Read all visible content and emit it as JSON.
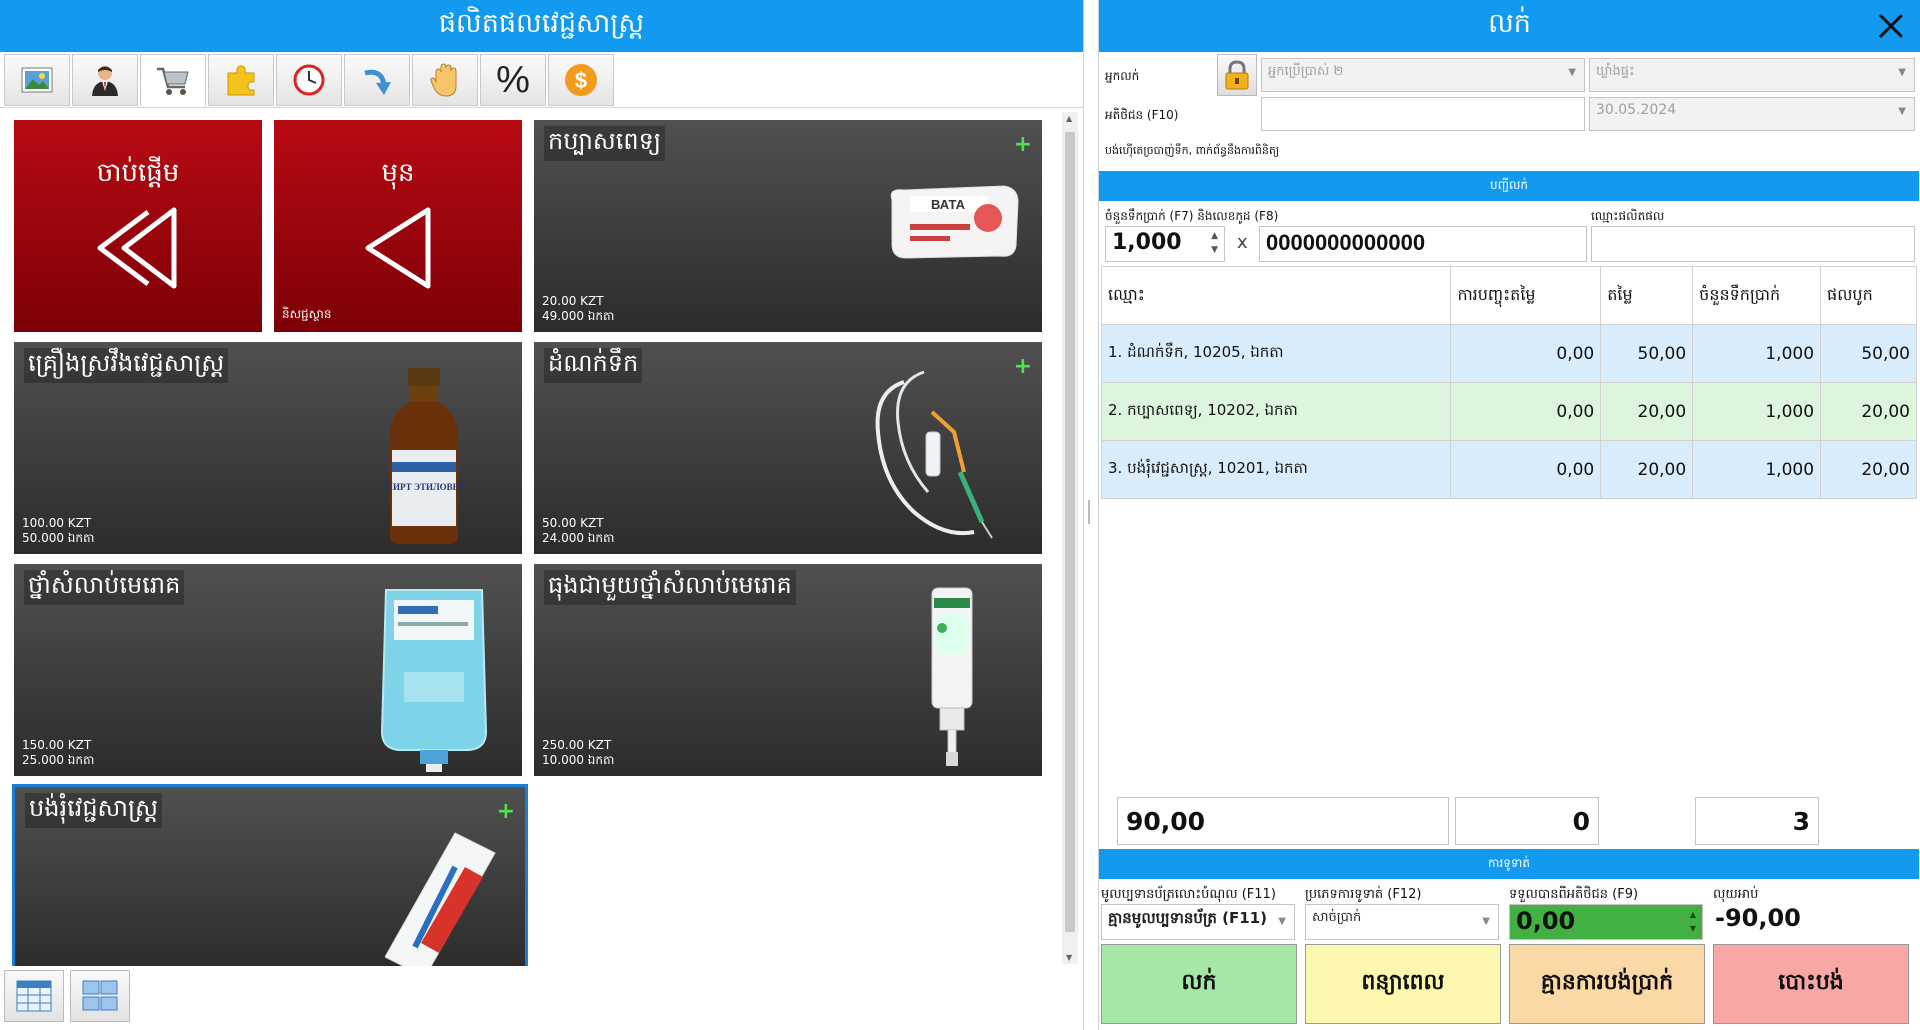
{
  "left": {
    "title": "ផលិតផលវេជ្ជសាស្ត្រ",
    "toolbar": [
      {
        "icon": "image-icon",
        "glyph": "🖼"
      },
      {
        "icon": "user-icon",
        "glyph": "👤"
      },
      {
        "icon": "cart-icon",
        "glyph": "🛒"
      },
      {
        "icon": "puzzle-icon",
        "glyph": "🧩"
      },
      {
        "icon": "clock-icon",
        "glyph": "🕓"
      },
      {
        "icon": "redo-arrow-icon",
        "glyph": "↷"
      },
      {
        "icon": "hand-icon",
        "glyph": "✋"
      },
      {
        "icon": "percent-icon",
        "glyph": "%"
      },
      {
        "icon": "dollar-coin-icon",
        "glyph": "$"
      }
    ],
    "tiles": {
      "start": {
        "label": "ចាប់ផ្តើម"
      },
      "prev": {
        "label": "មុន",
        "sub": "និសជ្ជស្ថាន"
      },
      "cotton": {
        "name": "កប្បាសពេទ្យ",
        "price": "20.00 KZT",
        "stock": "49.000 ឯកតា",
        "pkg_text": "ВАТА"
      },
      "alcohol": {
        "name": "គ្រឿងស្រវឹងវេជ្ជសាស្ត្រ",
        "price": "100.00 KZT",
        "stock": "50.000 ឯកតា",
        "label_text": "СПИРТ ЭТИЛОВЫЙ"
      },
      "dropper": {
        "name": "ដំណក់ទឹក",
        "price": "50.00 KZT",
        "stock": "24.000 ឯកតា"
      },
      "disinfectant": {
        "name": "ថ្នាំសំលាប់មេរោគ",
        "price": "150.00 KZT",
        "stock": "25.000 ឯកតា"
      },
      "disinfect_container": {
        "name": "ធុងជាមួយថ្នាំសំលាប់មេរោគ",
        "price": "250.00 KZT",
        "stock": "10.000 ឯកតា"
      },
      "bandage": {
        "name": "បង់រុំវេជ្ជសាស្ត្រ"
      }
    },
    "plus": "+"
  },
  "right": {
    "title": "លក់",
    "seller_label": "អ្នកលក់",
    "seller_value": "អ្នកប្រើប្រាស់ ២",
    "warehouse_value": "ឃ្លាំងផ្ទះ",
    "customer_label": "អតិថិជន (F10)",
    "customer_value": "",
    "date_value": "30.05.2024",
    "note": "បង់ហ៊ើតេច្របាញ់ទឹក, ពាក់ព័ន្ធនឹងការពិនិត្យ",
    "items_header": "បញ្ជីលក់",
    "qty_label": "ចំនួនទឹកប្រាក់ (F7) និងលេខកូដ (F8)",
    "product_name_label": "ឈ្មោះផលិតផល",
    "qty_value": "1,000",
    "times": "x",
    "barcode_value": "0000000000000",
    "columns": [
      "ឈ្មោះ",
      "ការបញ្ចុះតម្លៃ",
      "តម្លៃ",
      "ចំនួនទឹកប្រាក់",
      "ផលបូក"
    ],
    "rows": [
      {
        "name": "1. ដំណក់ទឹក, 10205, ឯកតា",
        "discount": "0,00",
        "price": "50,00",
        "qty": "1,000",
        "total": "50,00",
        "bg": "#d9ecfb"
      },
      {
        "name": "2. កប្បាសពេទ្យ, 10202, ឯកតា",
        "discount": "0,00",
        "price": "20,00",
        "qty": "1,000",
        "total": "20,00",
        "bg": "#ddf5dd"
      },
      {
        "name": "3. បង់រុំវេជ្ជសាស្ត្រ, 10201, ឯកតា",
        "discount": "0,00",
        "price": "20,00",
        "qty": "1,000",
        "total": "20,00",
        "bg": "#d9ecfb"
      }
    ],
    "total_sum": "90,00",
    "total_discount": "0",
    "total_count": "3",
    "payment_header": "ការទូទាត់",
    "fiscal_label": "មូលប្បទានប័ត្រលោះបំណុល (F11)",
    "fiscal_value": "គ្មានមូលប្បទានប័ត្រ (F11)",
    "paytype_label": "ប្រភេទការទូទាត់ (F12)",
    "paytype_value": "សាច់ប្រាក់",
    "received_label": "ទទួលបានពីអតិថិជន (F9)",
    "received_value": "0,00",
    "change_label": "លុយអាប់",
    "change_value": "-90,00",
    "buttons": {
      "sell": "លក់",
      "postpone": "ពន្យាពេល",
      "no_payment": "គ្មានការបង់ប្រាក់",
      "cancel": "បោះបង់"
    },
    "colors": {
      "accent": "#129af0",
      "sell": "#a6e7a6",
      "postpone": "#fbf7ae",
      "no_payment": "#fbd9a6",
      "cancel": "#f9a6a6",
      "received": "#43b043"
    }
  }
}
